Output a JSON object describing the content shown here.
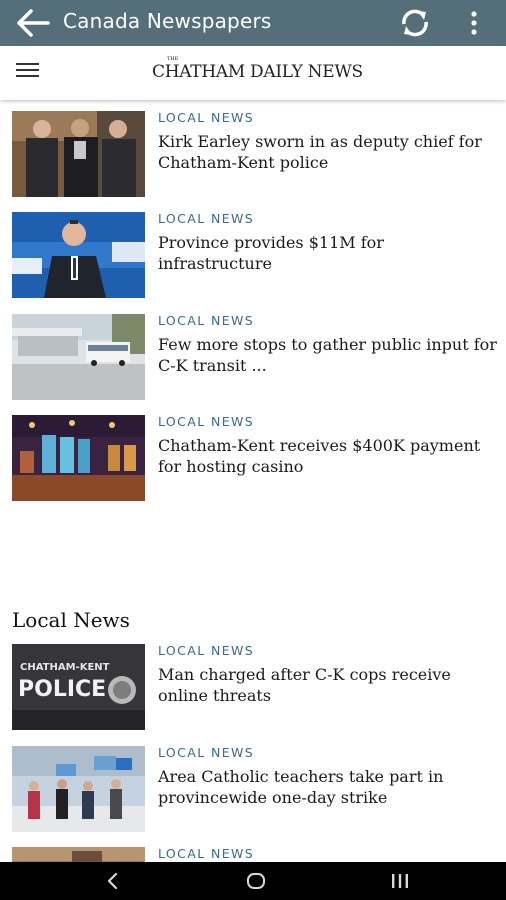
{
  "appbar": {
    "title": "Canada Newspapers",
    "back_icon": "arrow-left-icon",
    "refresh_icon": "refresh-icon",
    "more_icon": "more-vert-icon"
  },
  "site": {
    "masthead_the": "THE",
    "masthead": "CHATHAM DAILY NEWS",
    "menu_icon": "hamburger-icon"
  },
  "articles": [
    {
      "category": "LOCAL NEWS",
      "headline": "Kirk Earley sworn in as deputy chief for Chatham-Kent police"
    },
    {
      "category": "LOCAL NEWS",
      "headline": "Province provides $11M for infrastructure"
    },
    {
      "category": "LOCAL NEWS",
      "headline": "Few more stops to gather public input for C-K transit ..."
    },
    {
      "category": "LOCAL NEWS",
      "headline": "Chatham-Kent receives $400K payment for hosting casino"
    }
  ],
  "section": {
    "title": "Local News"
  },
  "local_articles": [
    {
      "category": "LOCAL NEWS",
      "headline": "Man charged after C-K cops receive online threats"
    },
    {
      "category": "LOCAL NEWS",
      "headline": "Area Catholic teachers take part in provincewide one-day strike"
    },
    {
      "category": "LOCAL NEWS",
      "headline": ""
    }
  ],
  "thumbs": {
    "police_lettering_1": "CHATHAM-KENT",
    "police_lettering_2": "POLICE"
  },
  "navbar": {
    "back_icon": "nav-back-icon",
    "home_icon": "nav-home-icon",
    "recents_icon": "nav-recents-icon"
  }
}
